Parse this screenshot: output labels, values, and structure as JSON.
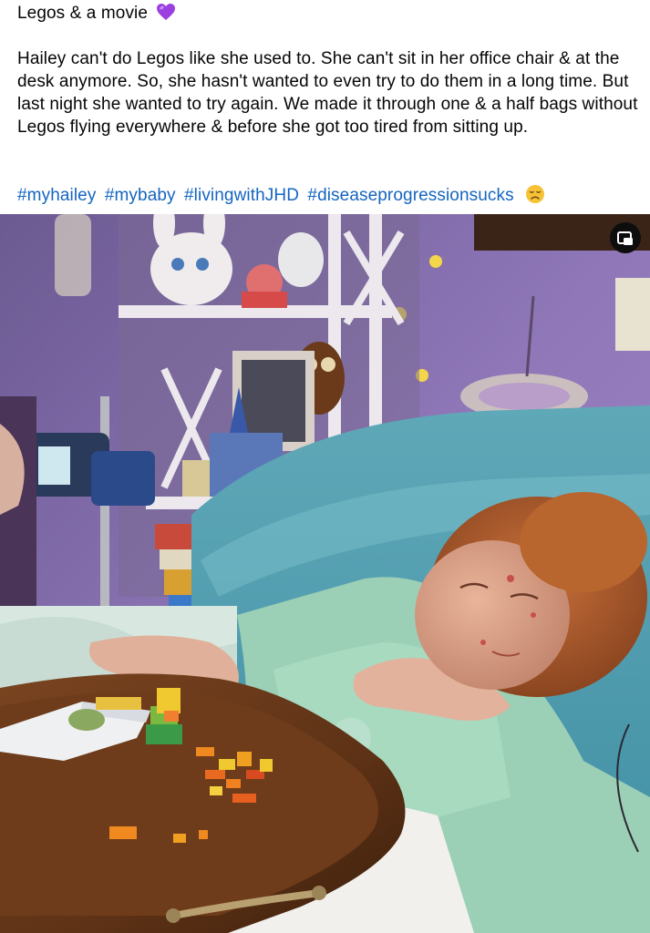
{
  "post": {
    "title": "Legos & a movie",
    "title_emoji": "purple-heart-icon",
    "body": "Hailey can't do Legos like she used to. She can't sit in her office chair & at the desk anymore. So, she hasn't wanted to even try to do them in a long time. But last night she wanted to try again. We made it through one & a half bags without Legos flying everywhere & before she got too tired from sitting up.",
    "hashtags": [
      "#myhailey",
      "#mybaby",
      "#livingwithJHD",
      "#diseaseprogressionsucks"
    ],
    "trailing_emoji": "disappointed-face-icon"
  },
  "photo": {
    "description_icon": "photo",
    "expand_icon": "picture-in-picture-icon"
  },
  "colors": {
    "text": "#050505",
    "link": "#1565c0",
    "heart": "#9b3fe0",
    "wall": "#8f77b8",
    "pillow": "#6fb5c2",
    "tray": "#6a3a18"
  }
}
